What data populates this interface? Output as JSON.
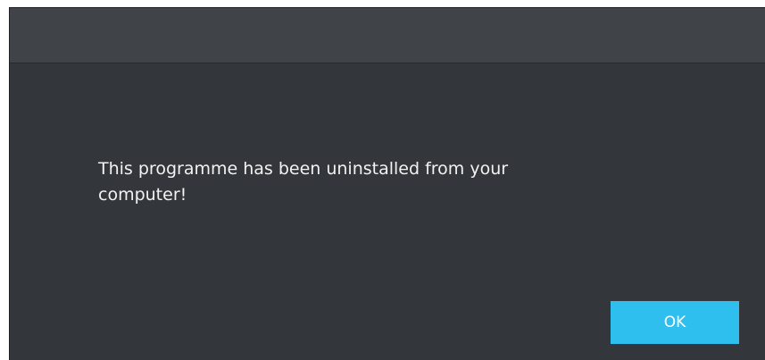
{
  "dialog": {
    "message": "This programme has been uninstalled from your\ncomputer!",
    "ok_label": "OK"
  },
  "colors": {
    "background": "#33363b",
    "titlebar": "#404347",
    "button": "#2fbfee",
    "text": "#f2f2f2"
  }
}
